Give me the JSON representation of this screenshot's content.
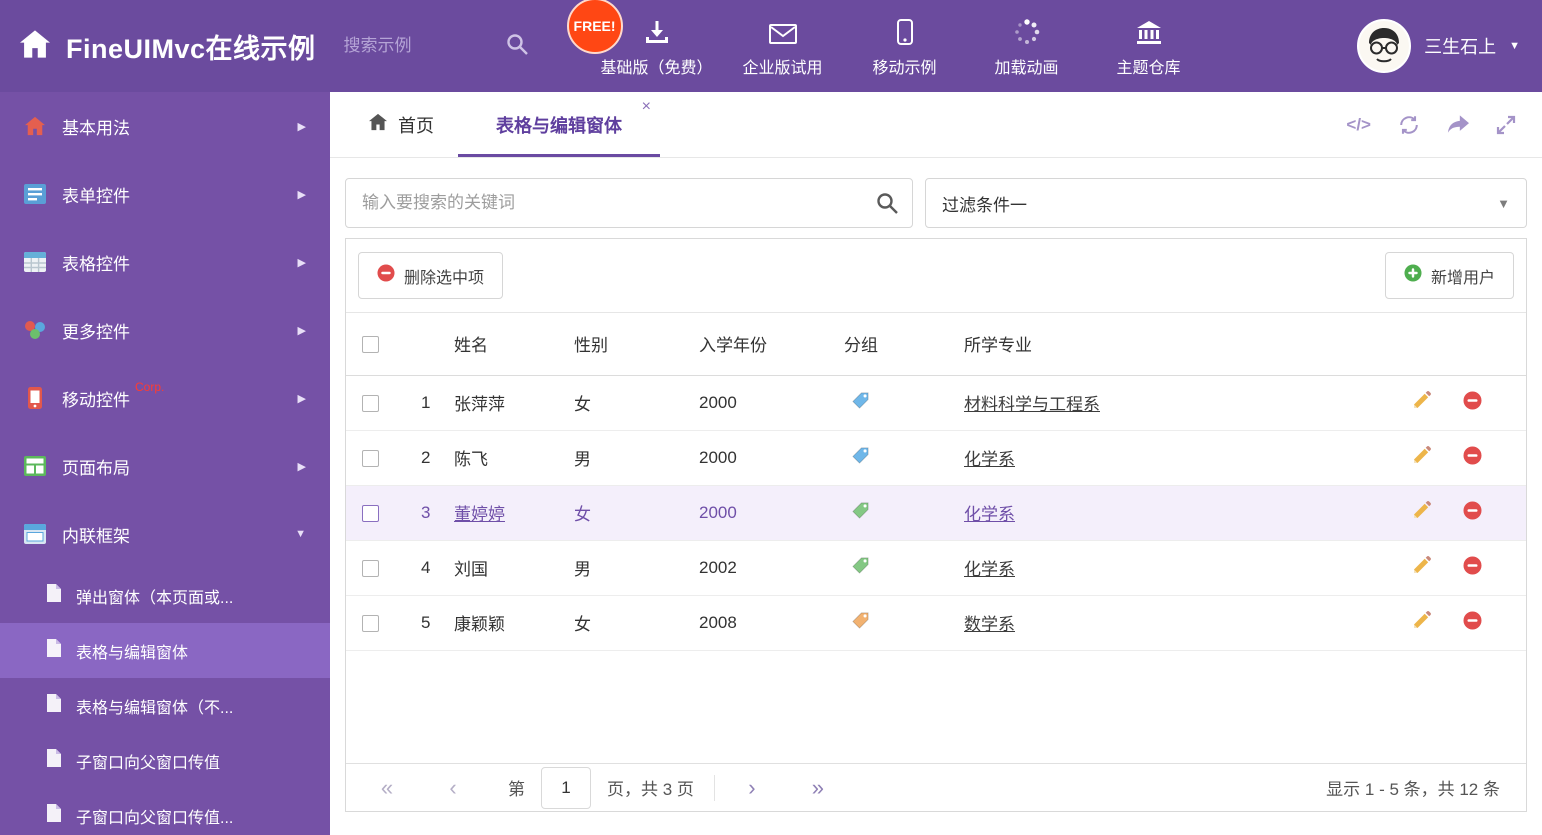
{
  "app": {
    "title": "FineUIMvc在线示例",
    "search_placeholder": "搜索示例",
    "free_badge": "FREE!",
    "user_name": "三生石上"
  },
  "top_nav": {
    "items": [
      {
        "label": "基础版（免费）"
      },
      {
        "label": "企业版试用"
      },
      {
        "label": "移动示例"
      },
      {
        "label": "加载动画"
      },
      {
        "label": "主题仓库"
      }
    ]
  },
  "sidebar": {
    "items": [
      {
        "label": "基本用法"
      },
      {
        "label": "表单控件"
      },
      {
        "label": "表格控件"
      },
      {
        "label": "更多控件"
      },
      {
        "label": "移动控件",
        "badge": "Corp."
      },
      {
        "label": "页面布局"
      },
      {
        "label": "内联框架"
      }
    ],
    "subitems": [
      {
        "label": "弹出窗体（本页面或..."
      },
      {
        "label": "表格与编辑窗体"
      },
      {
        "label": "表格与编辑窗体（不..."
      },
      {
        "label": "子窗口向父窗口传值"
      },
      {
        "label": "子窗口向父窗口传值..."
      }
    ]
  },
  "tabs": {
    "home_label": "首页",
    "active_label": "表格与编辑窗体",
    "code_tool": "</>"
  },
  "filter": {
    "search_placeholder": "输入要搜索的关键词",
    "dropdown_value": "过滤条件一"
  },
  "toolbar": {
    "delete_label": "删除选中项",
    "add_label": "新增用户"
  },
  "table": {
    "columns": {
      "name": "姓名",
      "gender": "性别",
      "year": "入学年份",
      "group": "分组",
      "major": "所学专业"
    },
    "rows": [
      {
        "num": "1",
        "name": "张萍萍",
        "gender": "女",
        "year": "2000",
        "tag": "blue",
        "major": "材料科学与工程系",
        "selected": false
      },
      {
        "num": "2",
        "name": "陈飞",
        "gender": "男",
        "year": "2000",
        "tag": "blue",
        "major": "化学系",
        "selected": false
      },
      {
        "num": "3",
        "name": "董婷婷",
        "gender": "女",
        "year": "2000",
        "tag": "green",
        "major": "化学系",
        "selected": true
      },
      {
        "num": "4",
        "name": "刘国",
        "gender": "男",
        "year": "2002",
        "tag": "green",
        "major": "化学系",
        "selected": false
      },
      {
        "num": "5",
        "name": "康颖颖",
        "gender": "女",
        "year": "2008",
        "tag": "orange",
        "major": "数学系",
        "selected": false
      }
    ]
  },
  "pagination": {
    "first": "«",
    "prev": "‹",
    "page_label_before": "第",
    "page_value": "1",
    "page_label_after": "页，共 3 页",
    "next": "›",
    "last": "»",
    "summary": "显示 1 - 5 条，共 12 条"
  },
  "colors": {
    "header_bg": "#6b4b9e",
    "sidebar_bg": "#7551a6",
    "sidebar_active_bg": "#8a67c3",
    "accent_purple": "#6a4aa2",
    "selected_row_bg": "#f4effb",
    "free_badge_bg": "#ff4714",
    "tag_blue": "#6fb7e9",
    "tag_green": "#84c884",
    "tag_orange": "#f2b271",
    "delete_red": "#e14c4c",
    "add_green": "#4fae4f",
    "pencil_yellow": "#edb54a"
  }
}
